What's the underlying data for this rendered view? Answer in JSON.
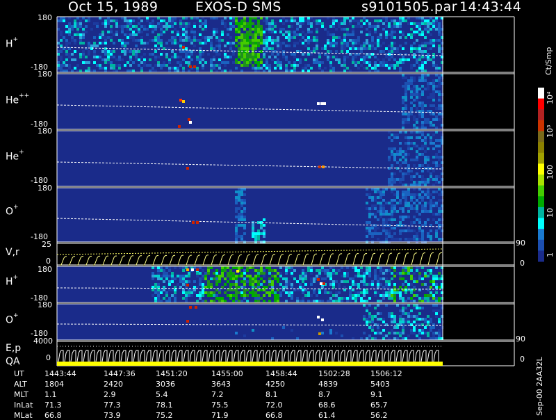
{
  "header": {
    "date": "Oct 15, 1989",
    "instrument": "EXOS-D SMS",
    "file": "s9101505.par",
    "time": "14:43:44"
  },
  "panels": [
    {
      "id": "h1",
      "label_main": "H",
      "label_sup": "+",
      "y_top": "180",
      "y_bottom": "-180"
    },
    {
      "id": "hepp",
      "label_main": "He",
      "label_sup": "++",
      "y_top": "180",
      "y_bottom": "-180"
    },
    {
      "id": "hep",
      "label_main": "He",
      "label_sup": "+",
      "y_top": "180",
      "y_bottom": "-180"
    },
    {
      "id": "op1",
      "label_main": "O",
      "label_sup": "+",
      "y_top": "180",
      "y_bottom": "-180"
    },
    {
      "id": "vr",
      "label_main": "V,r",
      "label_sup": "",
      "y_top": "25",
      "y_bottom": "0"
    },
    {
      "id": "h2",
      "label_main": "H",
      "label_sup": "+",
      "y_top": "180",
      "y_bottom": "-180"
    },
    {
      "id": "op2",
      "label_main": "O",
      "label_sup": "+",
      "y_top": "180",
      "y_bottom": "-180"
    },
    {
      "id": "ep",
      "label_main": "E,p",
      "label_sup": "",
      "y_top": "4000",
      "y_bottom": "0"
    }
  ],
  "qa_label": "QA",
  "right_axis": {
    "vr_top": "90",
    "vr_bottom": "0",
    "ep_top": "90",
    "ep_bottom": "0"
  },
  "colorbar": {
    "title": "Ct/Smp",
    "labels": [
      "10⁴",
      "10³",
      "100",
      "10",
      "1"
    ],
    "colors": [
      "#ffffff",
      "#ff0000",
      "#b22222",
      "#cc3300",
      "#7a6a1a",
      "#8b8000",
      "#a0a000",
      "#ffff00",
      "#a8e000",
      "#44cc00",
      "#00aa00",
      "#00b4a0",
      "#00ffff",
      "#1a7ad0",
      "#1c4fb0",
      "#1a2b8a"
    ]
  },
  "footer_id": "Sep-00 2AA32L",
  "orbit_table": {
    "rows": [
      {
        "label": "UT",
        "values": [
          "1443:44",
          "1447:36",
          "1451:20",
          "1455:00",
          "1458:44",
          "1502:28",
          "1506:12"
        ]
      },
      {
        "label": "ALT",
        "values": [
          "1804",
          "2420",
          "3036",
          "3643",
          "4250",
          "4839",
          "5403"
        ]
      },
      {
        "label": "MLT",
        "values": [
          "1.1",
          "2.9",
          "5.4",
          "7.2",
          "8.1",
          "8.7",
          "9.1"
        ]
      },
      {
        "label": "InLat",
        "values": [
          "71.3",
          "77.3",
          "78.1",
          "75.5",
          "72.0",
          "68.6",
          "65.7"
        ]
      },
      {
        "label": "MLat",
        "values": [
          "66.8",
          "73.9",
          "75.2",
          "71.9",
          "66.8",
          "61.4",
          "56.2"
        ]
      }
    ]
  },
  "chart_data": {
    "type": "heatmap",
    "x_ticks": [
      "1443:44",
      "1447:36",
      "1451:20",
      "1455:00",
      "1458:44",
      "1502:28",
      "1506:12"
    ],
    "panels": [
      "H+",
      "He++",
      "He+",
      "O+",
      "V,r",
      "H+",
      "O+",
      "E,p"
    ],
    "ylim_pitch": [
      -180,
      180
    ],
    "ylim_vr": [
      0,
      25
    ],
    "ylim_ep": [
      0,
      4000
    ],
    "color_scale": "log",
    "color_range": [
      1,
      10000
    ]
  }
}
